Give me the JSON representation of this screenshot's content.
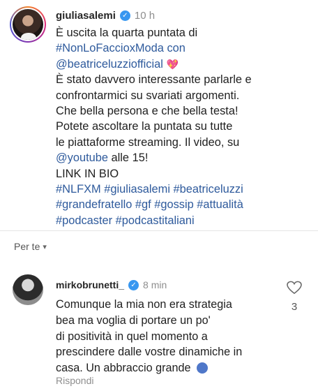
{
  "post": {
    "username": "giulia​salemi",
    "time": "10 h",
    "lines": [
      "È uscita la quarta puntata di",
      "#NonLoFaccioxModa con",
      "@beatriceluzziofficial",
      "È stato davvero interessante parlarle e",
      "confrontarmici su svariati argomenti.",
      "Che bella persona e che bella testa!",
      "Potete ascoltare la puntata su tutte",
      "le piattaforme streaming. Il video, su",
      "@youtube alle 15!",
      "LINK IN BIO",
      "#NLFXM #giuliasalemi #beatriceluzzi",
      "#grandefratello #gf #gossip #attualità",
      "#podcaster #podcastitaliani"
    ],
    "mention_youtube": "@youtube",
    "line9_rest": " alle 15!",
    "heart_icon": "heart-icon"
  },
  "sort": {
    "label": "Per te"
  },
  "comment": {
    "username": "mirkobrunetti_",
    "time": "8 min",
    "lines": [
      "Comunque la mia non era strategia",
      "bea ma voglia di portare un po'",
      "di positività in quel momento a",
      "prescindere dalle vostre dinamiche in",
      "casa. Un abbraccio grande"
    ],
    "reply_label": "Rispondi",
    "like_count": "3"
  },
  "colors": {
    "hashtag": "#2e5a9c",
    "verified": "#3897f0",
    "heart": "#e0457b",
    "meta": "#8e8e8e"
  }
}
